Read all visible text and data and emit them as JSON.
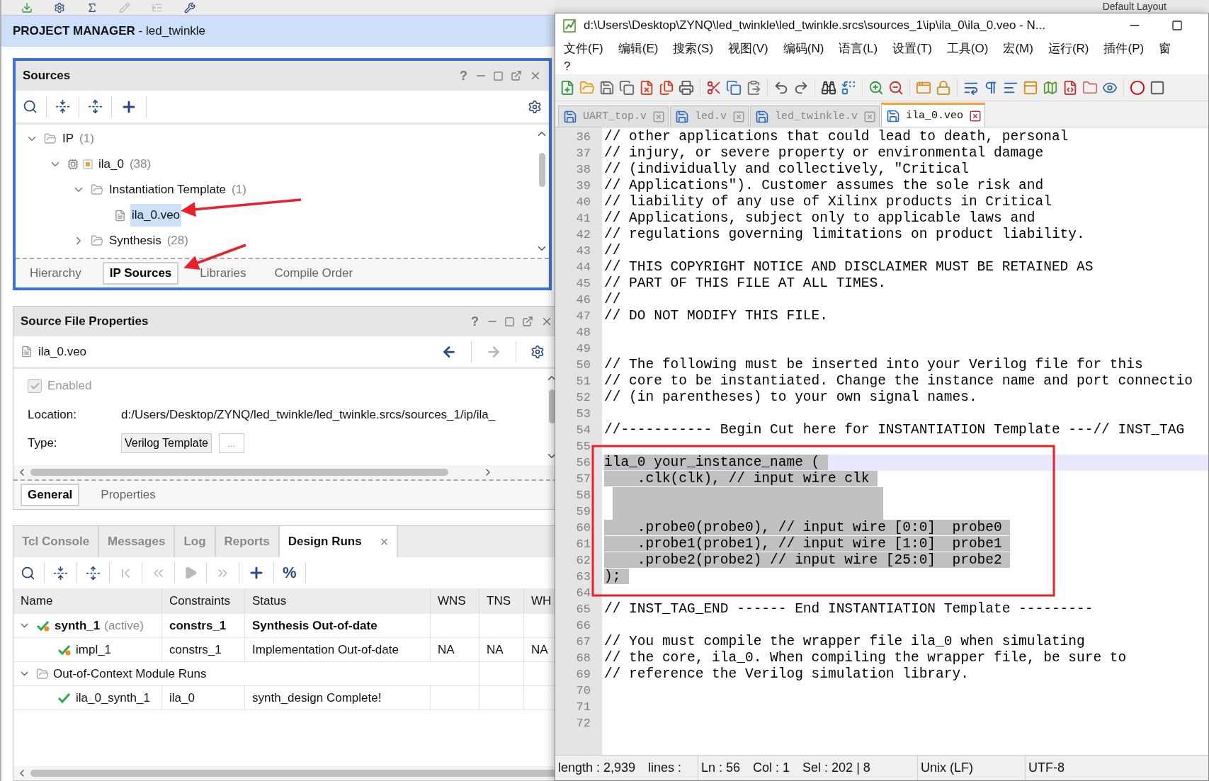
{
  "vivado": {
    "header": "**PROJECT MANAGER** - led_twinkle",
    "sources": {
      "title": "Sources",
      "help": "?",
      "tree": [
        {
          "kind": "folder",
          "label": "IP",
          "count": "(1)",
          "expanded": true,
          "selected": false,
          "children": [
            {
              "kind": "ip",
              "label": "ila_0",
              "count": "(38)",
              "expanded": true,
              "selected": false,
              "children": [
                {
                  "kind": "folder",
                  "label": "Instantiation Template",
                  "count": "(1)",
                  "expanded": true,
                  "selected": false,
                  "children": [
                    {
                      "kind": "file",
                      "label": "ila_0.veo",
                      "selected": true
                    }
                  ]
                },
                {
                  "kind": "folder",
                  "label": "Synthesis",
                  "count": "(28)",
                  "expanded": false,
                  "selected": false
                }
              ]
            }
          ]
        }
      ],
      "tabs": [
        {
          "label": "Hierarchy",
          "selected": false
        },
        {
          "label": "IP Sources",
          "selected": true
        },
        {
          "label": "Libraries",
          "selected": false
        },
        {
          "label": "Compile Order",
          "selected": false
        }
      ]
    },
    "properties": {
      "title": "Source File Properties",
      "help": "?",
      "file": "ila_0.veo",
      "enabled": {
        "label": "Enabled",
        "checked": true,
        "disabled": true
      },
      "fields": [
        {
          "kind": "text",
          "label": "Location:",
          "value": "d:/Users/Desktop/ZYNQ/led_twinkle/led_twinkle.srcs/sources_1/ip/ila_"
        },
        {
          "kind": "button",
          "label": "Type:",
          "value": "Verilog Template",
          "more": "..."
        }
      ],
      "tabs": [
        {
          "label": "General",
          "selected": true
        },
        {
          "label": "Properties",
          "selected": false
        }
      ]
    },
    "console": {
      "tabs": [
        {
          "label": "Tcl Console",
          "selected": false
        },
        {
          "label": "Messages",
          "selected": false
        },
        {
          "label": "Log",
          "selected": false
        },
        {
          "label": "Reports",
          "selected": false
        },
        {
          "label": "Design Runs",
          "selected": true,
          "close": "×"
        }
      ],
      "percent": "%",
      "columns": [
        "Name",
        "Constraints",
        "Status",
        "WNS",
        "TNS",
        "WH"
      ],
      "rows": [
        {
          "kind": "stale",
          "name": "synth_1",
          "note": "(active)",
          "active": true,
          "expanded": true,
          "cells": [
            "constrs_1",
            "Synthesis Out-of-date"
          ],
          "children": [
            {
              "kind": "stale",
              "name": "impl_1",
              "active": false,
              "cells": [
                "constrs_1",
                "Implementation Out-of-date",
                "NA",
                "NA",
                "NA"
              ]
            }
          ]
        },
        {
          "kind": "group",
          "name": "Out-of-Context Module Runs",
          "active": false,
          "expanded": true,
          "children": [
            {
              "kind": "done",
              "name": "ila_0_synth_1",
              "active": false,
              "cells": [
                "ila_0",
                "synth_design Complete!"
              ]
            }
          ]
        }
      ]
    }
  },
  "default_layout": "Default Layout",
  "editor": {
    "title": "d:\\Users\\Desktop\\ZYNQ\\led_twinkle\\led_twinkle.srcs\\sources_1\\ip\\ila_0\\ila_0.veo - N...",
    "menu": [
      "文件(F)",
      "编辑(E)",
      "搜索(S)",
      "视图(V)",
      "编码(N)",
      "语言(L)",
      "设置(T)",
      "工具(O)",
      "宏(M)",
      "运行(R)",
      "插件(P)",
      "窗"
    ],
    "menu_help": "?",
    "tabs": [
      {
        "label": "UART_top.v",
        "selected": false
      },
      {
        "label": "led.v",
        "selected": false
      },
      {
        "label": "led_twinkle.v",
        "selected": false
      },
      {
        "label": "ila_0.veo",
        "selected": true
      }
    ],
    "lines": [
      {
        "number": "36",
        "text": "// other applications that could lead to death, personal",
        "selected": false,
        "current": false
      },
      {
        "number": "37",
        "text": "// injury, or severe property or environmental damage",
        "selected": false,
        "current": false
      },
      {
        "number": "38",
        "text": "// (individually and collectively, \"Critical",
        "selected": false,
        "current": false
      },
      {
        "number": "39",
        "text": "// Applications\"). Customer assumes the sole risk and",
        "selected": false,
        "current": false
      },
      {
        "number": "40",
        "text": "// liability of any use of Xilinx products in Critical",
        "selected": false,
        "current": false
      },
      {
        "number": "41",
        "text": "// Applications, subject only to applicable laws and",
        "selected": false,
        "current": false
      },
      {
        "number": "42",
        "text": "// regulations governing limitations on product liability.",
        "selected": false,
        "current": false
      },
      {
        "number": "43",
        "text": "//",
        "selected": false,
        "current": false
      },
      {
        "number": "44",
        "text": "// THIS COPYRIGHT NOTICE AND DISCLAIMER MUST BE RETAINED AS",
        "selected": false,
        "current": false
      },
      {
        "number": "45",
        "text": "// PART OF THIS FILE AT ALL TIMES.",
        "selected": false,
        "current": false
      },
      {
        "number": "46",
        "text": "//",
        "selected": false,
        "current": false
      },
      {
        "number": "47",
        "text": "// DO NOT MODIFY THIS FILE.",
        "selected": false,
        "current": false
      },
      {
        "number": "48",
        "selected": false,
        "current": false
      },
      {
        "number": "49",
        "selected": false,
        "current": false
      },
      {
        "number": "50",
        "text": "// The following must be inserted into your Verilog file for this",
        "selected": false,
        "current": false
      },
      {
        "number": "51",
        "text": "// core to be instantiated. Change the instance name and port connectio",
        "selected": false,
        "current": false
      },
      {
        "number": "52",
        "text": "// (in parentheses) to your own signal names.",
        "selected": false,
        "current": false
      },
      {
        "number": "53",
        "selected": false,
        "current": false
      },
      {
        "number": "54",
        "text": "//----------- Begin Cut here for INSTANTIATION Template ---// INST_TAG",
        "selected": false,
        "current": false
      },
      {
        "number": "55",
        "selected": false,
        "current": false
      },
      {
        "number": "56",
        "text": "ila_0 your_instance_name (",
        "selected": true,
        "current": true
      },
      {
        "number": "57",
        "text": "    .clk(clk), // input wire clk",
        "selected": true,
        "current": false
      },
      {
        "number": "58",
        "selected": true,
        "current": false
      },
      {
        "number": "59",
        "selected": true,
        "current": false
      },
      {
        "number": "60",
        "text": "    .probe0(probe0), // input wire [0:0]  probe0",
        "selected": true,
        "current": false
      },
      {
        "number": "61",
        "text": "    .probe1(probe1), // input wire [1:0]  probe1",
        "selected": true,
        "current": false
      },
      {
        "number": "62",
        "text": "    .probe2(probe2) // input wire [25:0]  probe2",
        "selected": true,
        "current": false
      },
      {
        "number": "63",
        "text": ");",
        "selected": true,
        "current": false
      },
      {
        "number": "64",
        "selected": false,
        "current": false
      },
      {
        "number": "65",
        "text": "// INST_TAG_END ------ End INSTANTIATION Template ---------",
        "selected": false,
        "current": false
      },
      {
        "number": "66",
        "selected": false,
        "current": false
      },
      {
        "number": "67",
        "text": "// You must compile the wrapper file ila_0 when simulating",
        "selected": false,
        "current": false
      },
      {
        "number": "68",
        "text": "// the core, ila_0. When compiling the wrapper file, be sure to",
        "selected": false,
        "current": false
      },
      {
        "number": "69",
        "text": "// reference the Verilog simulation library.",
        "selected": false,
        "current": false
      },
      {
        "number": "70",
        "selected": false,
        "current": false
      },
      {
        "number": "71",
        "selected": false,
        "current": false
      },
      {
        "number": "72",
        "selected": false,
        "current": false
      }
    ],
    "status": [
      [
        "length : 2,939",
        "lines :"
      ],
      [
        "Ln : 56",
        "Col : 1",
        "Sel : 202 | 8"
      ],
      [
        "Unix (LF)"
      ],
      [
        "UTF-8"
      ]
    ]
  }
}
